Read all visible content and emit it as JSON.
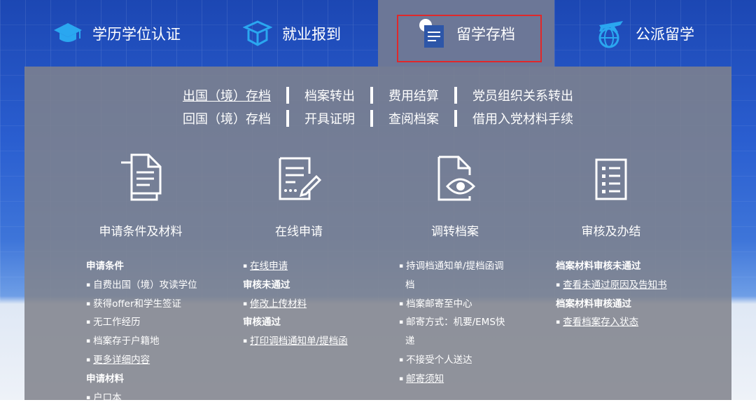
{
  "tabs": [
    {
      "label": "学历学位认证",
      "icon": "graduation-cap-icon"
    },
    {
      "label": "就业报到",
      "icon": "mortarboard-box-icon"
    },
    {
      "label": "留学存档",
      "icon": "archive-document-icon",
      "active": true
    },
    {
      "label": "公派留学",
      "icon": "airplane-globe-icon"
    }
  ],
  "links": {
    "row1": [
      "出国（境）存档",
      "档案转出",
      "费用结算",
      "党员组织关系转出"
    ],
    "row2": [
      "回国（境）存档",
      "开具证明",
      "查阅档案",
      "借用入党材料手续"
    ]
  },
  "steps": [
    {
      "label": "申请条件及材料",
      "icon": "documents-icon"
    },
    {
      "label": "在线申请",
      "icon": "form-edit-icon"
    },
    {
      "label": "调转档案",
      "icon": "document-view-icon"
    },
    {
      "label": "审核及办结",
      "icon": "checklist-icon"
    }
  ],
  "col1": {
    "h1": "申请条件",
    "i1": "自费出国（境）攻读学位",
    "i2": "获得offer和学生签证",
    "i3": "无工作经历",
    "i4": "档案存于户籍地",
    "i5": "更多详细内容",
    "h2": "申请材料",
    "i6": "户口本"
  },
  "col2": {
    "i1": "在线申请",
    "h1": "审核未通过",
    "i2": "修改上传材料",
    "h2": "审核通过",
    "i3": "打印调档通知单/提档函"
  },
  "col3": {
    "i1a": "持调档通知单/提档函调",
    "i1b": "档",
    "i2": "档案邮寄至中心",
    "i3a": "邮寄方式：机要/EMS快",
    "i3b": "递",
    "i4": "不接受个人送达",
    "i5": "邮寄须知"
  },
  "col4": {
    "h1": "档案材料审核未通过",
    "i1": "查看未通过原因及告知书",
    "h2": "档案材料审核通过",
    "i2": "查看档案存入状态"
  },
  "colors": {
    "active_tab": "#6c7797",
    "highlight": "#e0282a",
    "icon_blue": "#2aa7f0"
  }
}
